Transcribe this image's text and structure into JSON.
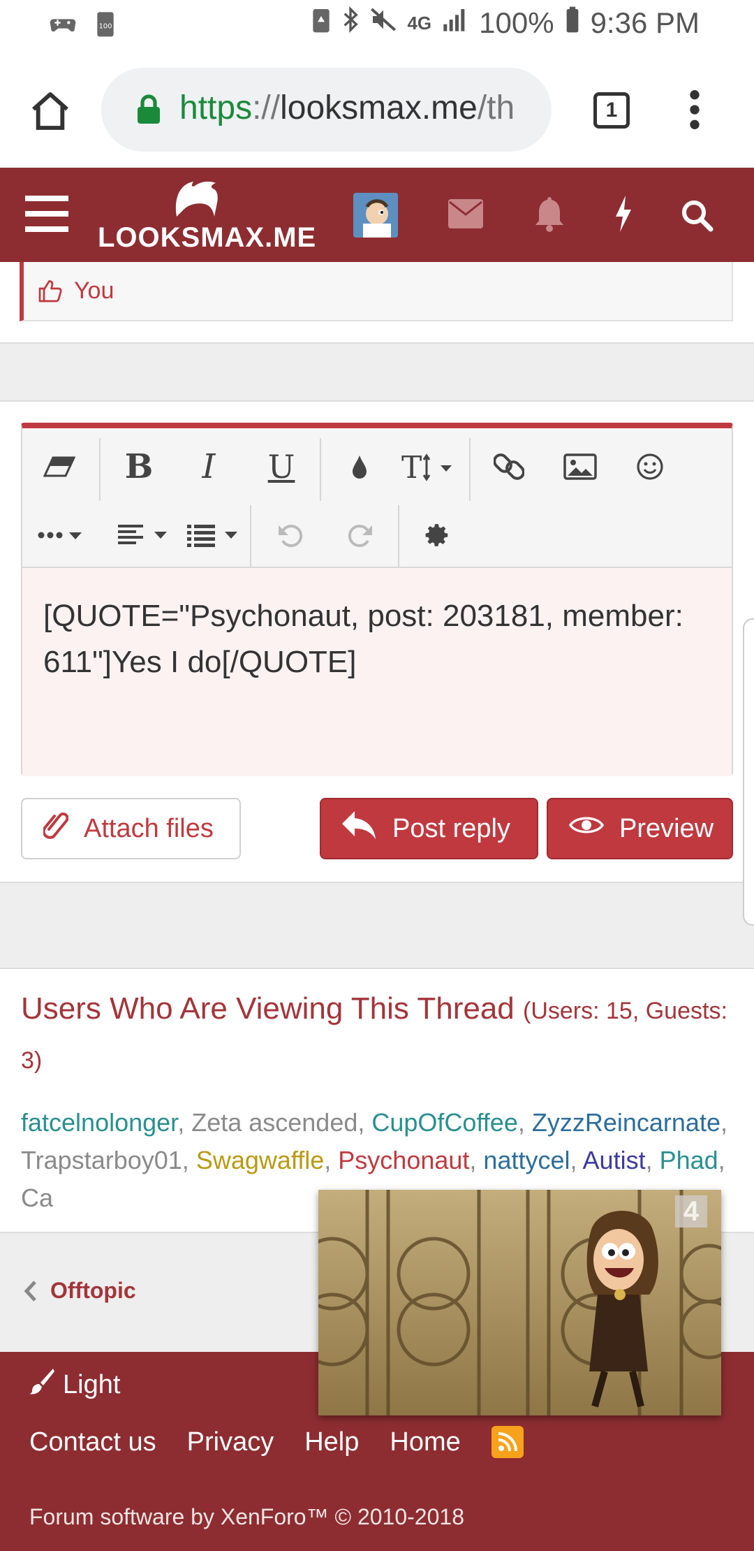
{
  "status_bar": {
    "battery": "100%",
    "time": "9:36 PM",
    "network": "4G"
  },
  "browser": {
    "url_scheme": "https",
    "url_separator": "://",
    "url_host": "looksmax.me",
    "url_path": "/th",
    "tab_count": "1"
  },
  "header": {
    "site_name": "LOOKSMAX.ME"
  },
  "reaction": {
    "label": "You"
  },
  "editor": {
    "content": "[QUOTE=\"Psychonaut, post: 203181, member: 611\"]Yes I do[/QUOTE]"
  },
  "actions": {
    "attach_label": "Attach files",
    "post_reply_label": "Post reply",
    "preview_label": "Preview"
  },
  "viewers": {
    "title": "Users Who Are Viewing This Thread",
    "counts": "(Users: 15, Guests: 3)",
    "users": [
      {
        "name": "fatcelnolonger",
        "cls": "u-teal"
      },
      {
        "name": "Zeta ascended",
        "cls": "u-grey"
      },
      {
        "name": "CupOfCoffee",
        "cls": "u-teal"
      },
      {
        "name": "ZyzzReincarnate",
        "cls": "u-blue"
      },
      {
        "name": "Trapstarboy01",
        "cls": "u-grey"
      },
      {
        "name": "Swagwaffle",
        "cls": "u-gold"
      },
      {
        "name": "Psychonaut",
        "cls": "u-red"
      },
      {
        "name": "nattycel",
        "cls": "u-blue"
      },
      {
        "name": "Autist",
        "cls": "u-navy"
      },
      {
        "name": "Phad",
        "cls": "u-teal"
      },
      {
        "name": "Ca",
        "cls": "u-grey"
      }
    ]
  },
  "breadcrumb": {
    "label": "Offtopic"
  },
  "footer": {
    "style_label": "Light",
    "links": [
      "Contact us",
      "Privacy",
      "Help",
      "Home"
    ],
    "copyright": "Forum software by XenForo™ © 2010-2018"
  },
  "video": {
    "badge": "4"
  },
  "colors": {
    "brand": "#8d2d31",
    "accent": "#c0393f"
  }
}
